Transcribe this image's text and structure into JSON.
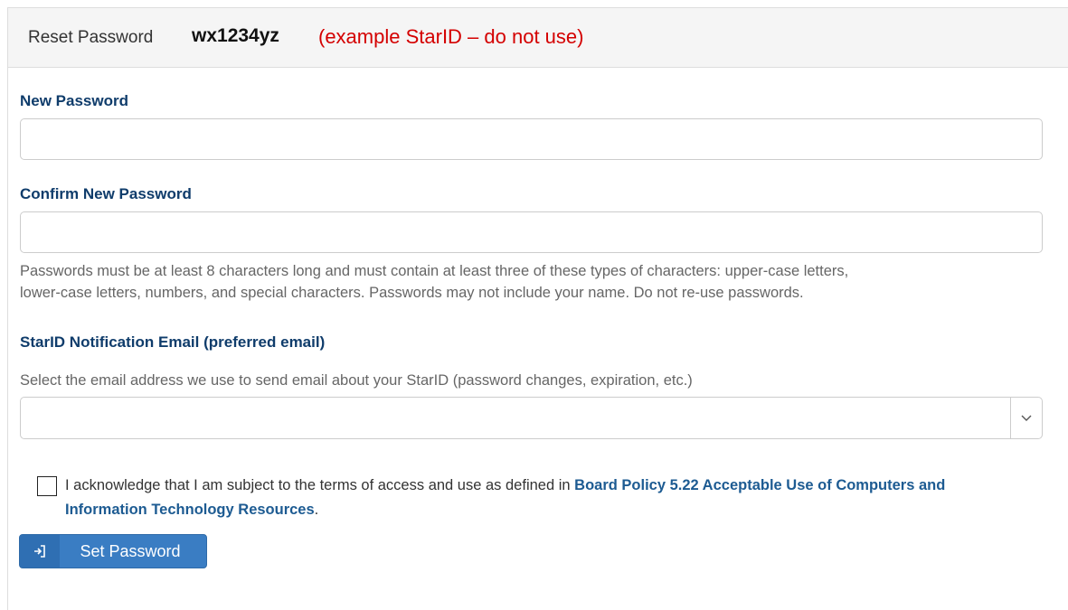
{
  "header": {
    "title": "Reset Password",
    "starid": "wx1234yz",
    "note": "(example StarID – do not use)"
  },
  "new_password": {
    "label": "New Password",
    "value": ""
  },
  "confirm_password": {
    "label": "Confirm New Password",
    "value": ""
  },
  "password_rules": {
    "line1": "Passwords must be at least 8 characters long and must contain at least three of these types of characters: upper-case letters,",
    "line2": "lower-case letters, numbers, and special characters. Passwords may not include your name. Do not re-use passwords."
  },
  "notification_email": {
    "label": "StarID Notification Email (preferred email)",
    "description": "Select the email address we use to send email about your StarID (password changes, expiration, etc.)",
    "selected_value": "",
    "arrow_icon": "chevron-down-icon"
  },
  "acknowledgement": {
    "checked": false,
    "text": "I acknowledge that I am subject to the terms of access and use as defined in ",
    "link_text": "Board Policy 5.22 Acceptable Use of Computers and Information Technology Resources",
    "suffix": "."
  },
  "submit": {
    "label": "Set Password",
    "icon": "sign-in-icon"
  },
  "colors": {
    "label": "#0f3c6b",
    "link": "#1d5b92",
    "note": "#d40000",
    "button": "#3a7dc3"
  }
}
